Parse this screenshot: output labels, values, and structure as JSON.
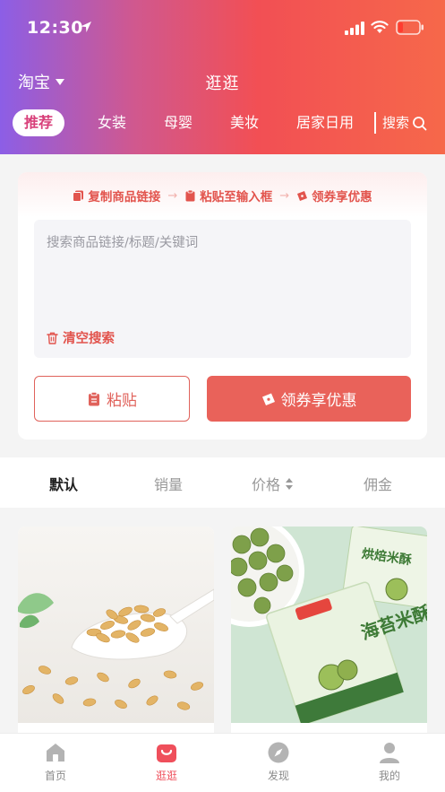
{
  "status_bar": {
    "time": "12:30"
  },
  "header": {
    "platform": "淘宝",
    "title": "逛逛",
    "tabs": [
      {
        "label": "推荐",
        "active": true
      },
      {
        "label": "女装",
        "active": false
      },
      {
        "label": "母婴",
        "active": false
      },
      {
        "label": "美妆",
        "active": false
      },
      {
        "label": "居家日用",
        "active": false
      }
    ],
    "search_label": "搜索"
  },
  "steps": {
    "step1": "复制商品链接",
    "step2": "粘贴至输入框",
    "step3": "领券享优惠",
    "arrow": "→"
  },
  "search_box": {
    "placeholder": "搜索商品链接/标题/关键词",
    "value": "",
    "clear_label": "清空搜索"
  },
  "buttons": {
    "paste_label": "粘贴",
    "coupon_label": "领券享优惠"
  },
  "sort": [
    {
      "label": "默认",
      "active": true
    },
    {
      "label": "销量",
      "active": false
    },
    {
      "label": "价格",
      "active": false
    },
    {
      "label": "佣金",
      "active": false
    }
  ],
  "products": {
    "p2_package_text": "海苔米酥"
  },
  "tabbar": [
    {
      "label": "首页",
      "icon": "home-icon",
      "active": false
    },
    {
      "label": "逛逛",
      "icon": "shopping-bag-icon",
      "active": true
    },
    {
      "label": "发现",
      "icon": "compass-icon",
      "active": false
    },
    {
      "label": "我的",
      "icon": "user-icon",
      "active": false
    }
  ],
  "colors": {
    "accent": "#e9625a",
    "active_tab_text": "#d8407a",
    "tabbar_active": "#ef4f5b"
  }
}
